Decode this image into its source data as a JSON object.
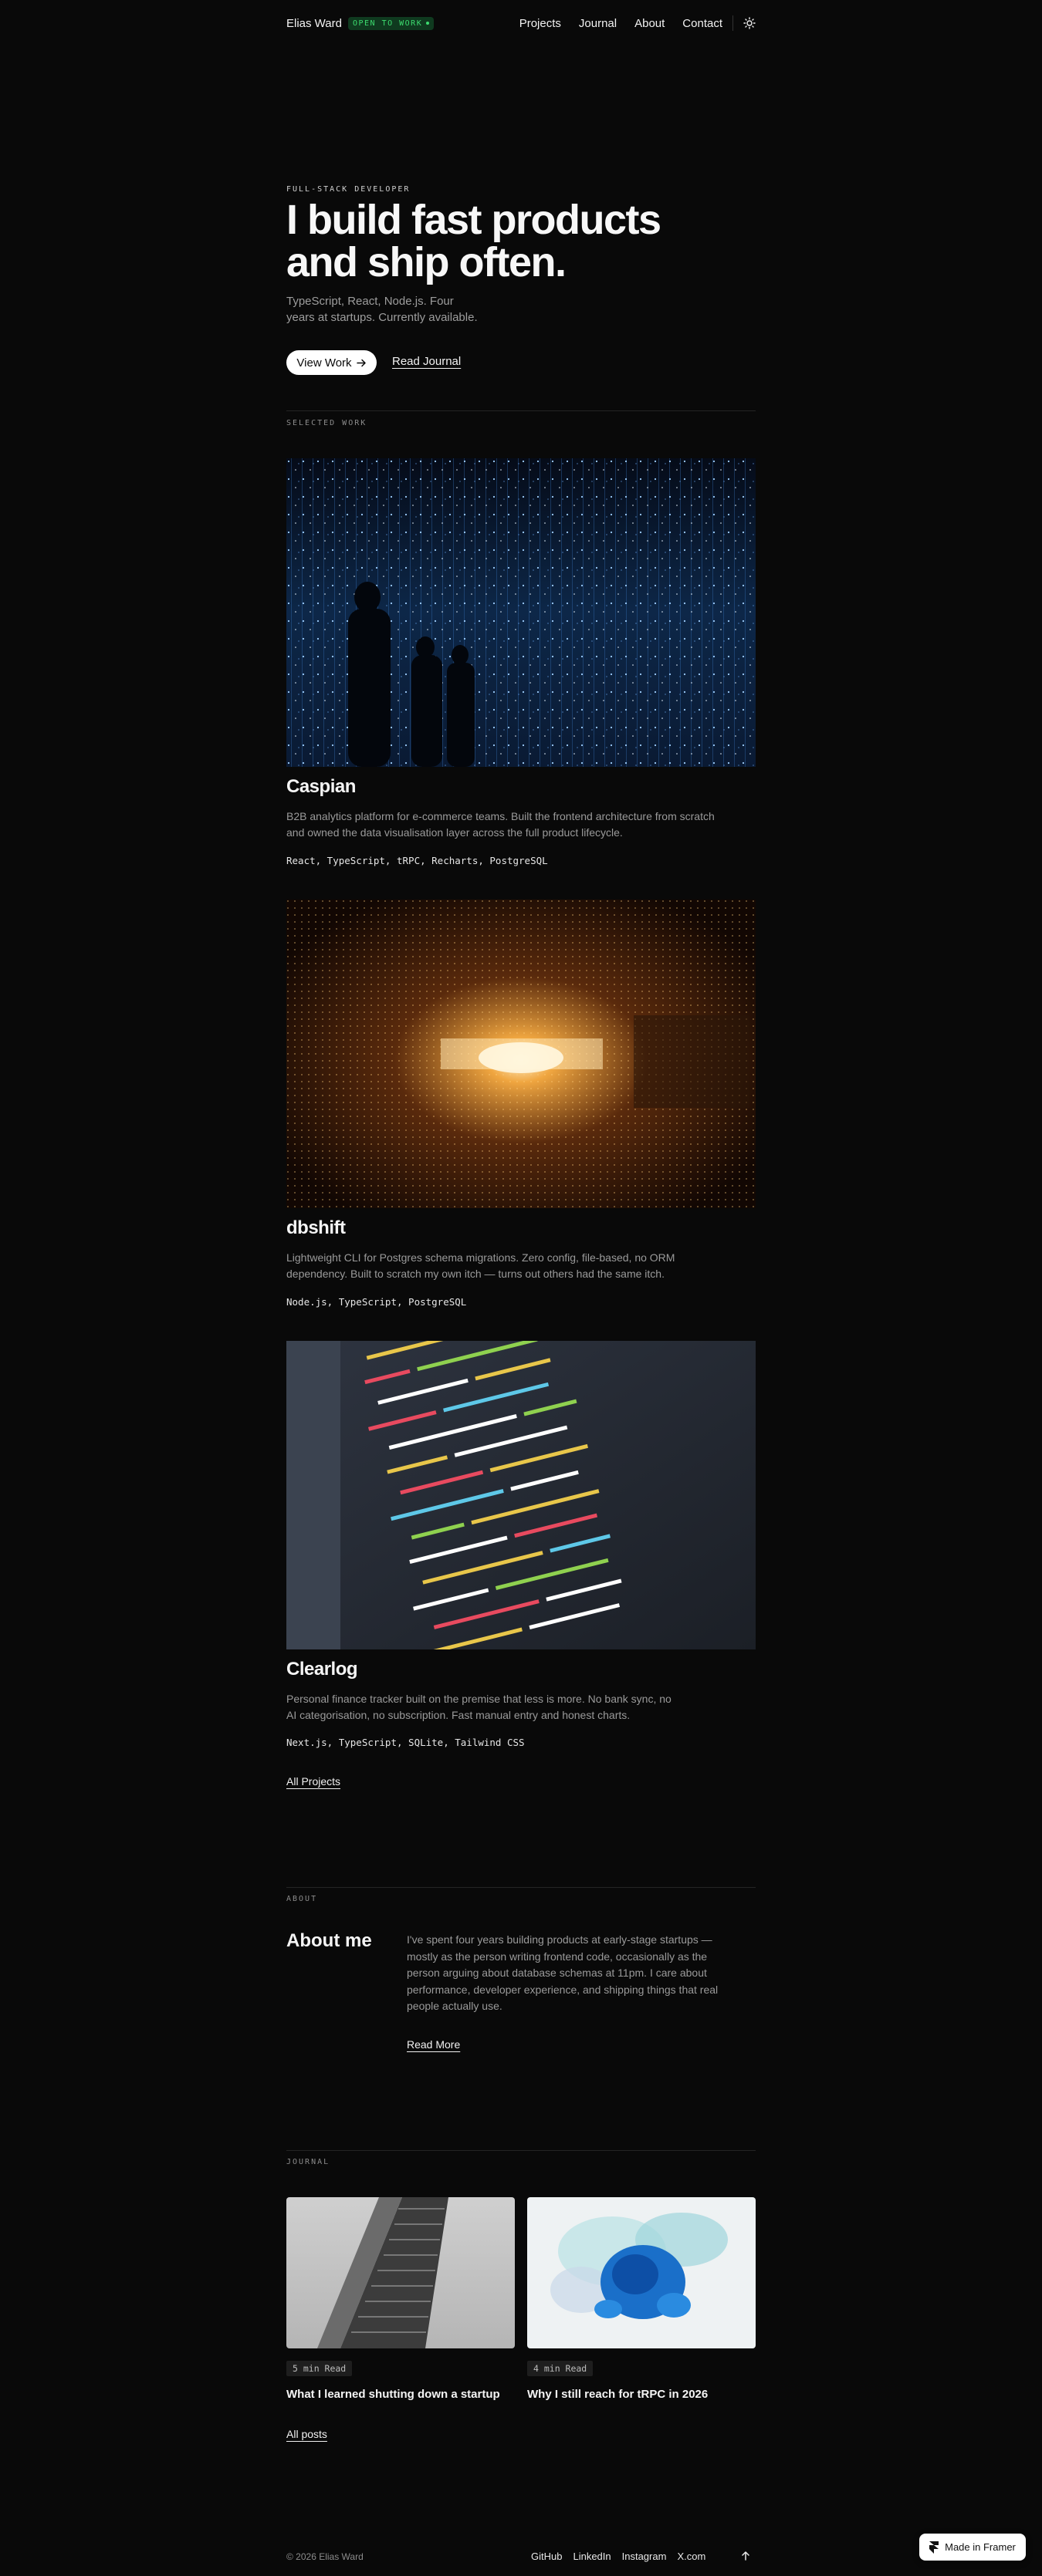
{
  "nav": {
    "brand": "Elias Ward",
    "badge": "OPEN TO WORK",
    "links": [
      "Projects",
      "Journal",
      "About",
      "Contact"
    ],
    "theme_icon": "sun-icon"
  },
  "hero": {
    "eyebrow": "FULL-STACK DEVELOPER",
    "title": "I build fast products and ship often.",
    "subtitle": "TypeScript, React, Node.js. Four years at startups. Currently available.",
    "primary_button": "View Work",
    "secondary_link": "Read Journal"
  },
  "work": {
    "label": "SELECTED WORK",
    "projects": [
      {
        "title": "Caspian",
        "description": "B2B analytics platform for e-commerce teams. Built the frontend architecture from scratch and owned the data visualisation layer across the full product lifecycle.",
        "tags": "React, TypeScript, tRPC, Recharts, PostgreSQL",
        "image": "blue-light-installation-image"
      },
      {
        "title": "dbshift",
        "description": "Lightweight CLI for Postgres schema migrations. Zero config, file-based, no ORM dependency. Built to scratch my own itch — turns out others had the same itch.",
        "tags": "Node.js, TypeScript, PostgreSQL",
        "image": "golden-light-tunnel-image"
      },
      {
        "title": "Clearlog",
        "description": "Personal finance tracker built on the premise that less is more. No bank sync, no AI categorisation, no subscription. Fast manual entry and honest charts.",
        "tags": "Next.js, TypeScript, SQLite, Tailwind CSS",
        "image": "code-editor-screen-image"
      }
    ],
    "all_link": "All Projects"
  },
  "about": {
    "label": "ABOUT",
    "title": "About me",
    "text": "I've spent four years building products at early-stage startups — mostly as the person writing frontend code, occasionally as the person arguing about database schemas at 11pm. I care about performance, developer experience, and shipping things that real people actually use.",
    "link": "Read More"
  },
  "journal": {
    "label": "JOURNAL",
    "posts": [
      {
        "read_time": "5 min Read",
        "title": "What I learned shutting down a startup",
        "image": "building-corner-image"
      },
      {
        "read_time": "4 min Read",
        "title": "Why I still reach for tRPC in 2026",
        "image": "blue-ink-splash-image"
      }
    ],
    "all_link": "All posts"
  },
  "footer": {
    "copyright": "© 2026 Elias Ward",
    "links": [
      "GitHub",
      "LinkedIn",
      "Instagram",
      "X.com"
    ],
    "up_icon": "arrow-up-icon"
  },
  "framer_badge": "Made in Framer",
  "colors": {
    "background": "#090909",
    "text": "#f2f2f2",
    "muted": "#9a9a9a",
    "badge_bg": "#0f3a1f",
    "badge_text": "#3ddc6f"
  }
}
